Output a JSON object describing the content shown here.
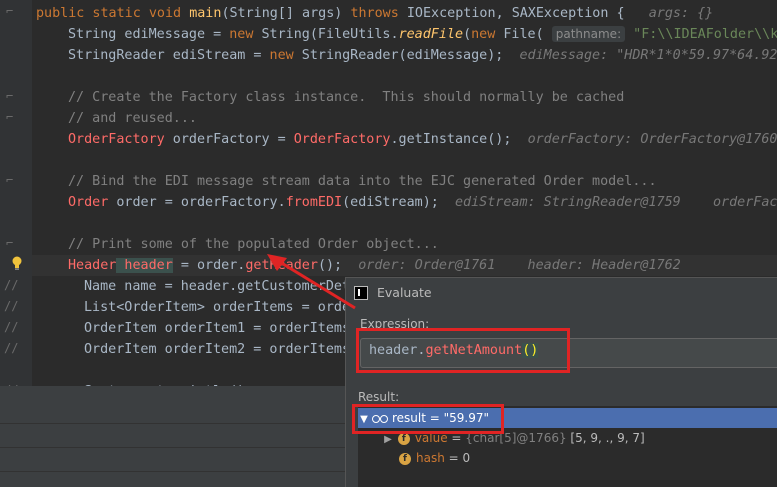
{
  "editor": {
    "line1": {
      "mods": "public static void ",
      "method": "main",
      "params": "(String[] args) ",
      "throws_kw": "throws ",
      "exc1": "IOException",
      "comma": ", ",
      "exc2": "SAXException",
      "brace": " {",
      "hint": "args: {}"
    },
    "line2": {
      "type": "String ediMessage = ",
      "new_kw": "new ",
      "ctor": "String(FileUtils.",
      "call": "readFile",
      "open": "(",
      "new_kw2": "new ",
      "file": "File(",
      "param_hint": "pathname:",
      "path": "\"F:\\\\IDEAFolder\\\\kin"
    },
    "line3": {
      "code": "StringReader ediStream = ",
      "new_kw": "new ",
      "ctor": "StringReader(ediMessage);",
      "hint": "ediMessage: \"HDR*1*0*59.97*64.92"
    },
    "comment1": "// Create the Factory class instance.  This should normally be cached",
    "comment2": "// and reused...",
    "line4": {
      "type": "OrderFactory",
      "code": " orderFactory = ",
      "type2": "OrderFactory",
      "call": ".getInstance();",
      "hint": "orderFactory: OrderFactory@1760"
    },
    "comment3": "// Bind the EDI message stream data into the EJC generated Order model...",
    "line5": {
      "type": "Order",
      "code": " order = orderFactory.",
      "call": "fromEDI",
      "rest": "(ediStream);",
      "hint": "ediStream: StringReader@1759    orderFact"
    },
    "comment4": "// Print some of the populated Order object...",
    "line6": {
      "type": "Header",
      "var": " header",
      "eq": " = order.",
      "call": "getHeader",
      "rest": "();",
      "hint": "order: Order@1761    header: Header@1762"
    },
    "line7": "Name name = header.getCustomerDet",
    "line8": "List<OrderItem> orderItems = orde",
    "line9": "OrderItem orderItem1 = orderItems",
    "line10": "OrderItem orderItem2 = orderItems",
    "line11": "System.out.println();",
    "gutter_comment": "//"
  },
  "dialog": {
    "title": "Evaluate",
    "expression_label": "Expression:",
    "expression": {
      "obj": "header.",
      "method": "getNetAmount",
      "parens": "()"
    },
    "result_label": "Result:",
    "result_row": "result = \"59.97\"",
    "value_row": {
      "name": "value",
      "eq": " = ",
      "type": "{char[5]@1766} ",
      "val": "[5, 9, ., 9, 7]"
    },
    "hash_row": {
      "name": "hash",
      "rest": " = 0"
    },
    "field_icon": "f"
  },
  "colors": {
    "highlight_red": "#e02424",
    "selection": "#4b6eaf",
    "keyword": "#cc7832"
  }
}
